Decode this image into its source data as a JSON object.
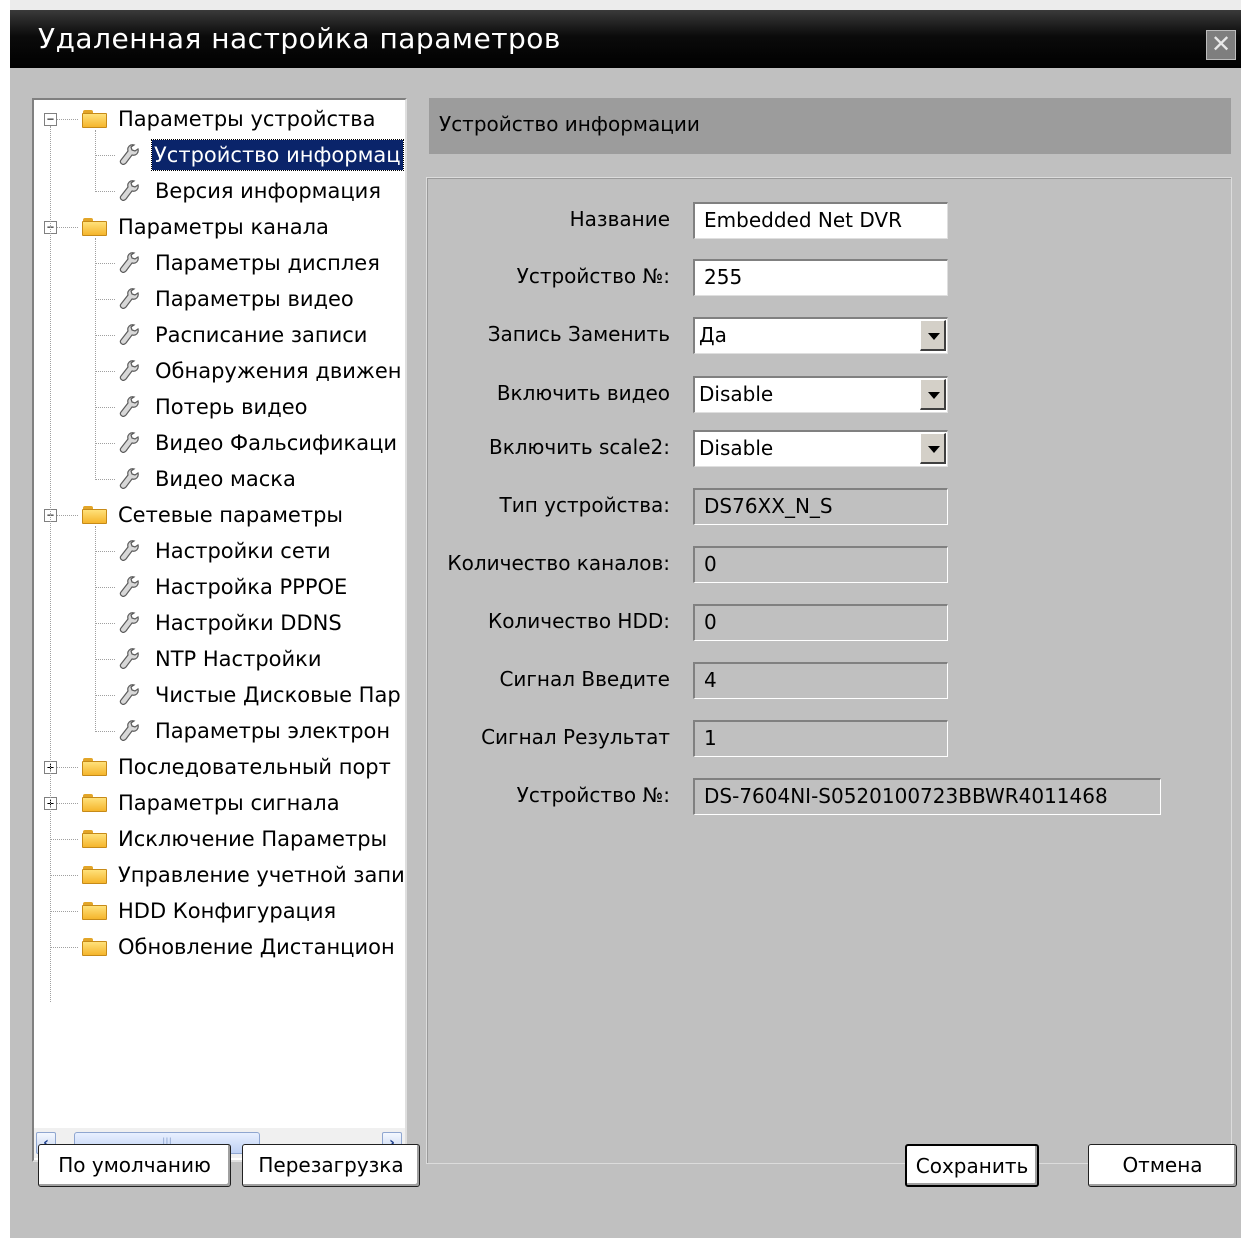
{
  "window": {
    "title": "Удаленная настройка параметров",
    "close_glyph": "✕"
  },
  "tree": {
    "items": [
      {
        "label": "Параметры устройства",
        "level": 0,
        "icon": "folder-icon",
        "expander": "−",
        "selected": false
      },
      {
        "label": "Устройство информац",
        "level": 1,
        "icon": "wrench-icon",
        "selected": true
      },
      {
        "label": "Версия информация",
        "level": 1,
        "icon": "wrench-icon",
        "selected": false
      },
      {
        "label": "Параметры канала",
        "level": 0,
        "icon": "folder-icon",
        "expander": "−",
        "selected": false
      },
      {
        "label": "Параметры дисплея",
        "level": 1,
        "icon": "wrench-icon",
        "selected": false
      },
      {
        "label": "Параметры видео",
        "level": 1,
        "icon": "wrench-icon",
        "selected": false
      },
      {
        "label": "Расписание записи",
        "level": 1,
        "icon": "wrench-icon",
        "selected": false
      },
      {
        "label": "Обнаружения движен",
        "level": 1,
        "icon": "wrench-icon",
        "selected": false
      },
      {
        "label": "Потерь видео",
        "level": 1,
        "icon": "wrench-icon",
        "selected": false
      },
      {
        "label": "Видео Фальсификаци",
        "level": 1,
        "icon": "wrench-icon",
        "selected": false
      },
      {
        "label": "Видео маска",
        "level": 1,
        "icon": "wrench-icon",
        "selected": false
      },
      {
        "label": "Сетевые параметры",
        "level": 0,
        "icon": "folder-icon",
        "expander": "−",
        "selected": false
      },
      {
        "label": "Настройки сети",
        "level": 1,
        "icon": "wrench-icon",
        "selected": false
      },
      {
        "label": "Настройка PPPOE",
        "level": 1,
        "icon": "wrench-icon",
        "selected": false
      },
      {
        "label": "Настройки DDNS",
        "level": 1,
        "icon": "wrench-icon",
        "selected": false
      },
      {
        "label": "NTP Настройки",
        "level": 1,
        "icon": "wrench-icon",
        "selected": false
      },
      {
        "label": "Чистые Дисковые Пар",
        "level": 1,
        "icon": "wrench-icon",
        "selected": false
      },
      {
        "label": "Параметры электрон",
        "level": 1,
        "icon": "wrench-icon",
        "selected": false
      },
      {
        "label": "Последовательный порт",
        "level": 0,
        "icon": "folder-icon",
        "expander": "+",
        "selected": false
      },
      {
        "label": "Параметры сигнала",
        "level": 0,
        "icon": "folder-icon",
        "expander": "+",
        "selected": false
      },
      {
        "label": "Исключение Параметры",
        "level": 0,
        "icon": "folder-icon",
        "expander": "",
        "selected": false
      },
      {
        "label": "Управление учетной запи",
        "level": 0,
        "icon": "folder-icon",
        "expander": "",
        "selected": false
      },
      {
        "label": "HDD Конфигурация",
        "level": 0,
        "icon": "folder-icon",
        "expander": "",
        "selected": false
      },
      {
        "label": "Обновление Дистанцион",
        "level": 0,
        "icon": "folder-icon",
        "expander": "",
        "selected": false
      }
    ],
    "scrollbar": {
      "left_glyph": "‹",
      "thumb_grip": "|||",
      "right_glyph": "›"
    }
  },
  "section": {
    "title": "Устройство информации"
  },
  "form": {
    "fields": [
      {
        "label": "Название",
        "value": "Embedded Net DVR",
        "kind": "edit"
      },
      {
        "label": "Устройство №:",
        "value": "255",
        "kind": "edit"
      },
      {
        "label": "Запись Заменить",
        "value": "Да",
        "kind": "combo"
      },
      {
        "label": "Включить видео",
        "value": "Disable",
        "kind": "combo"
      },
      {
        "label": "Включить scale2:",
        "value": "Disable",
        "kind": "combo"
      },
      {
        "label": "Тип устройства:",
        "value": "DS76XX_N_S",
        "kind": "readonly"
      },
      {
        "label": "Количество каналов:",
        "value": "0",
        "kind": "readonly"
      },
      {
        "label": "Количество HDD:",
        "value": "0",
        "kind": "readonly"
      },
      {
        "label": "Сигнал Введите",
        "value": "4",
        "kind": "readonly"
      },
      {
        "label": "Сигнал Результат",
        "value": "1",
        "kind": "readonly"
      },
      {
        "label": "Устройство №:",
        "value": "DS-7604NI-S0520100723BBWR4011468",
        "kind": "readonly"
      }
    ]
  },
  "buttons": {
    "default_label": "По умолчанию",
    "reboot_label": "Перезагрузка",
    "save_label": "Сохранить",
    "cancel_label": "Отмена"
  },
  "colors": {
    "titlebar": "#000000",
    "background": "#c0c0c0",
    "selection": "#0a246a",
    "section_header": "#9c9c9c"
  }
}
